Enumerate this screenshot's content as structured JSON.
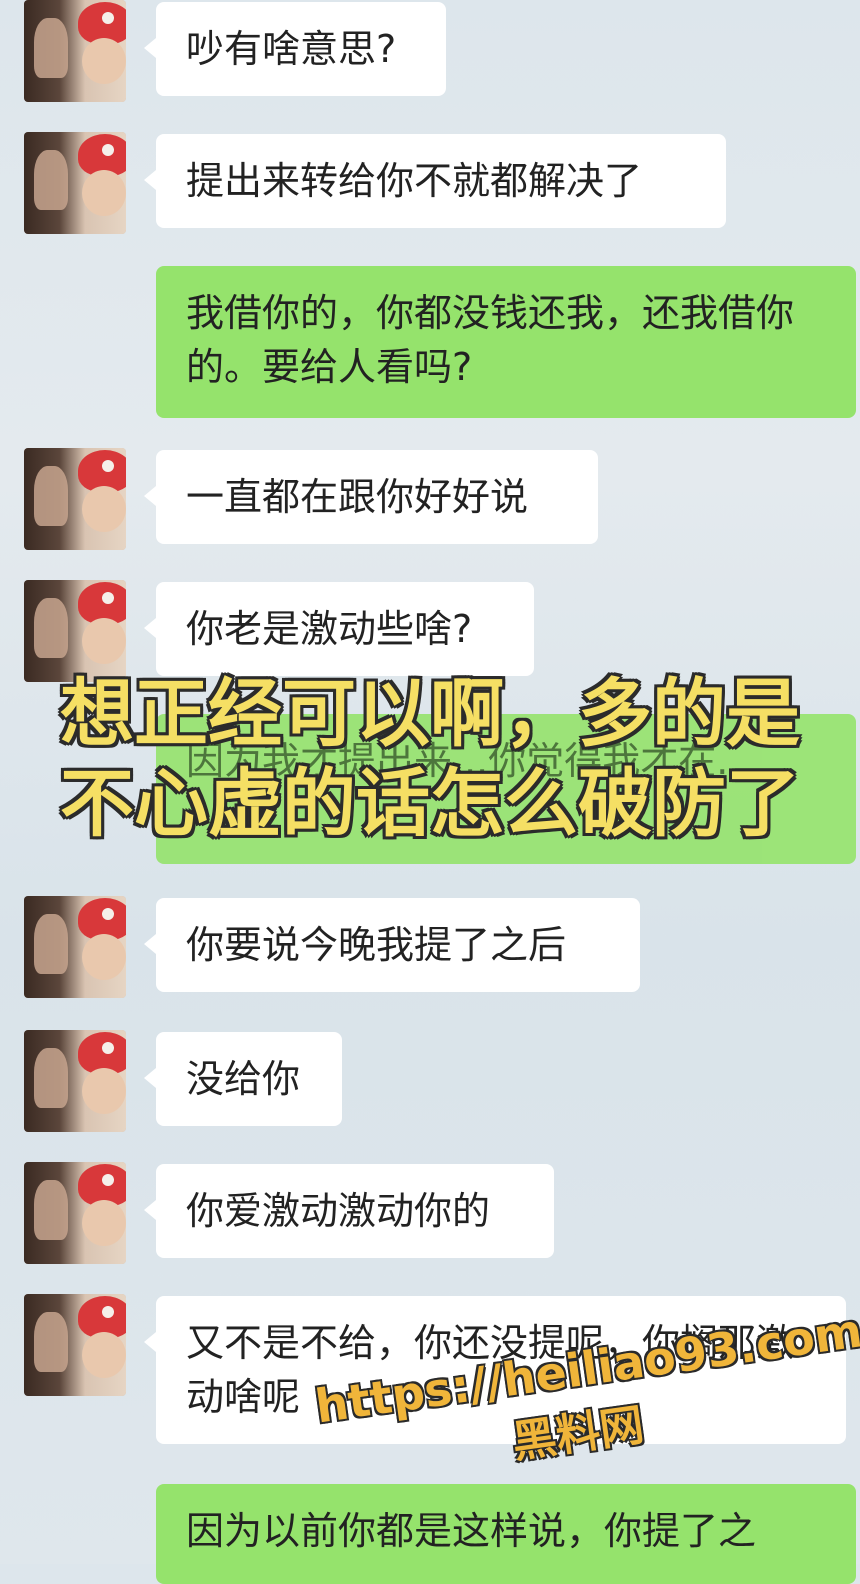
{
  "messages": [
    {
      "side": "in",
      "text": "吵有啥意思?"
    },
    {
      "side": "in",
      "text": "提出来转给你不就都解决了"
    },
    {
      "side": "out",
      "text": "我借你的，你都没钱还我，还我借你的。要给人看吗?"
    },
    {
      "side": "in",
      "text": "一直都在跟你好好说"
    },
    {
      "side": "in",
      "text": "你老是激动些啥?"
    },
    {
      "side": "out",
      "text": "因为我才提出来...你觉得我才在..."
    },
    {
      "side": "in",
      "text": "你要说今晚我提了之后"
    },
    {
      "side": "in",
      "text": "没给你"
    },
    {
      "side": "in",
      "text": "你爱激动激动你的"
    },
    {
      "side": "in",
      "text": "又不是不给，你还没提呢，你搁那激动啥呢"
    },
    {
      "side": "out",
      "text": "因为以前你都是这样说，你提了之"
    }
  ],
  "overlay": {
    "line1": "想正经可以啊，多的是",
    "line2": "不心虚的话怎么破防了"
  },
  "watermark": {
    "url": "https://heiliao93.com",
    "name": "黑料网"
  },
  "colors": {
    "incoming_bubble": "#ffffff",
    "outgoing_bubble": "#95e36c",
    "overlay_text": "#f5df64",
    "watermark_text": "#f0b53a"
  }
}
